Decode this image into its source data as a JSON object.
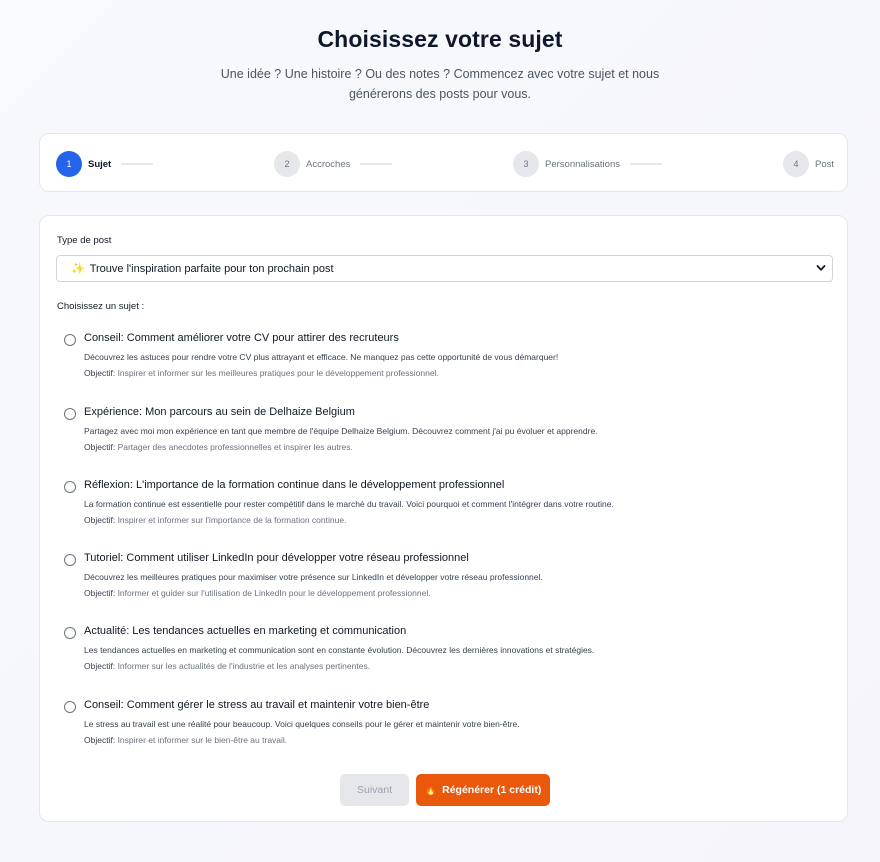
{
  "header": {
    "title": "Choisissez votre sujet",
    "subtitle": "Une idée ? Une histoire ? Ou des notes ? Commencez avec votre sujet et nous générerons des posts pour vous."
  },
  "stepper": {
    "steps": [
      {
        "num": "1",
        "label": "Sujet",
        "active": true
      },
      {
        "num": "2",
        "label": "Accroches",
        "active": false
      },
      {
        "num": "3",
        "label": "Personnalisations",
        "active": false
      },
      {
        "num": "4",
        "label": "Post",
        "active": false
      }
    ]
  },
  "form": {
    "post_type_label": "Type de post",
    "post_type_icon": "sparkle-icon",
    "post_type_value": "Trouve l'inspiration parfaite pour ton prochain post",
    "choose_label": "Choisissez un sujet :",
    "objective_prefix": "Objectif:",
    "topics": [
      {
        "title": "Conseil: Comment améliorer votre CV pour attirer des recruteurs",
        "description": "Découvrez les astuces pour rendre votre CV plus attrayant et efficace. Ne manquez pas cette opportunité de vous démarquer!",
        "objective": "Inspirer et informer sur les meilleures pratiques pour le développement professionnel."
      },
      {
        "title": "Expérience: Mon parcours au sein de Delhaize Belgium",
        "description": "Partagez avec moi mon expérience en tant que membre de l'équipe Delhaize Belgium. Découvrez comment j'ai pu évoluer et apprendre.",
        "objective": "Partager des anecdotes professionnelles et inspirer les autres."
      },
      {
        "title": "Réflexion: L'importance de la formation continue dans le développement professionnel",
        "description": "La formation continue est essentielle pour rester compétitif dans le marché du travail. Voici pourquoi et comment l'intégrer dans votre routine.",
        "objective": "Inspirer et informer sur l'importance de la formation continue."
      },
      {
        "title": "Tutoriel: Comment utiliser LinkedIn pour développer votre réseau professionnel",
        "description": "Découvrez les meilleures pratiques pour maximiser votre présence sur LinkedIn et développer votre réseau professionnel.",
        "objective": "Informer et guider sur l'utilisation de LinkedIn pour le développement professionnel."
      },
      {
        "title": "Actualité: Les tendances actuelles en marketing et communication",
        "description": "Les tendances actuelles en marketing et communication sont en constante évolution. Découvrez les dernières innovations et stratégies.",
        "objective": "Informer sur les actualités de l'industrie et les analyses pertinentes."
      },
      {
        "title": "Conseil: Comment gérer le stress au travail et maintenir votre bien-être",
        "description": "Le stress au travail est une réalité pour beaucoup. Voici quelques conseils pour le gérer et maintenir votre bien-être.",
        "objective": "Inspirer et informer sur le bien-être au travail."
      }
    ]
  },
  "actions": {
    "next_label": "Suivant",
    "regenerate_label": "Régénérer (1 crédit)",
    "regenerate_icon": "flame-icon"
  },
  "colors": {
    "primary": "#2563eb",
    "accent": "#ea580c"
  }
}
